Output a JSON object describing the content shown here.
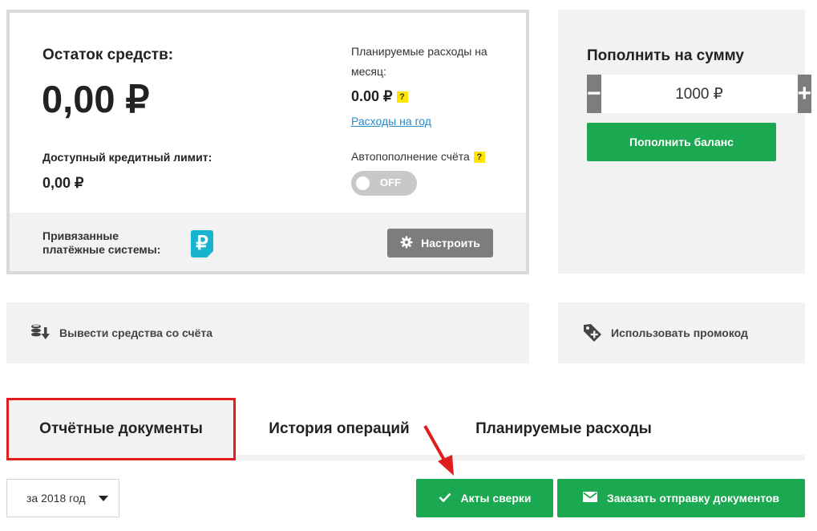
{
  "balance": {
    "title": "Остаток средств:",
    "amount": "0,00 ₽",
    "credit_label": "Доступный кредитный лимит:",
    "credit_value": "0,00 ₽",
    "planned_label": "Планируемые расходы на месяц:",
    "planned_value": "0.00 ₽",
    "help_mark": "?",
    "year_link": "Расходы на год",
    "autorefill_label": "Автопополнение счёта",
    "autorefill_state": "OFF",
    "linked_systems_label": "Привязанные платёжные системы:",
    "payment_system_icon": "ruble-icon",
    "payment_system_glyph": "₽",
    "configure_label": "Настроить"
  },
  "topup": {
    "title": "Пополнить на сумму",
    "minus": "−",
    "plus": "+",
    "amount_value": "1000 ₽",
    "submit_label": "Пополнить баланс"
  },
  "actions": {
    "withdraw_label": "Вывести средства со счёта",
    "promo_label": "Использовать промокод"
  },
  "tabs": [
    {
      "label": "Отчётные документы",
      "active": true
    },
    {
      "label": "История операций",
      "active": false
    },
    {
      "label": "Планируемые расходы",
      "active": false
    }
  ],
  "documents": {
    "year_filter": "за 2018 год",
    "acts_label": "Акты сверки",
    "order_label": "Заказать отправку документов"
  },
  "colors": {
    "green": "#1aa851",
    "gray_button": "#7d7d7d",
    "panel": "#f2f2f2",
    "link": "#2b89c8",
    "highlight": "#e01d1d",
    "help_badge": "#ffe500"
  }
}
